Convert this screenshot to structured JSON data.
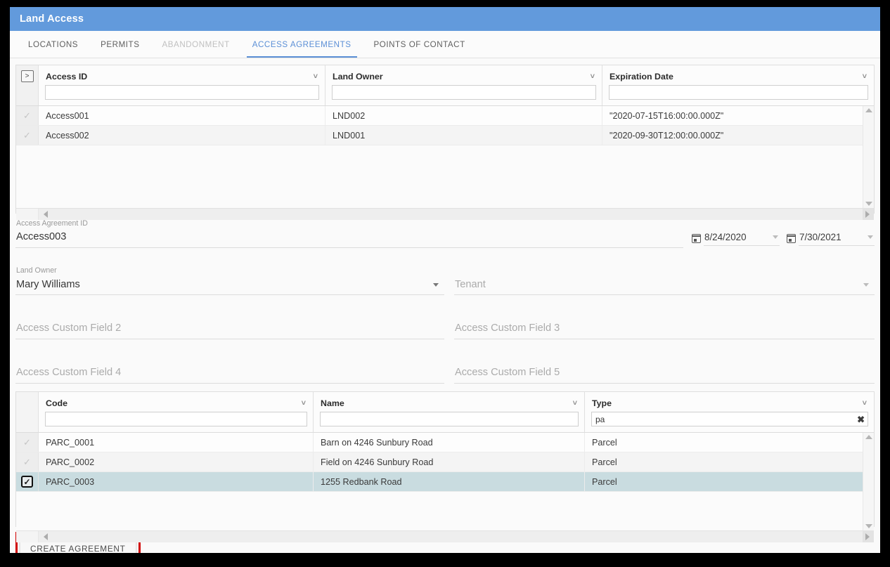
{
  "window": {
    "title": "Land Access"
  },
  "tabs": [
    {
      "label": "LOCATIONS",
      "state": "normal"
    },
    {
      "label": "PERMITS",
      "state": "normal"
    },
    {
      "label": "ABANDONMENT",
      "state": "disabled"
    },
    {
      "label": "ACCESS AGREEMENTS",
      "state": "active"
    },
    {
      "label": "POINTS OF CONTACT",
      "state": "normal"
    }
  ],
  "agreements_grid": {
    "expand_button_label": ">",
    "columns": [
      {
        "label": "Access ID",
        "filter_value": "",
        "filter_placeholder": ""
      },
      {
        "label": "Land Owner",
        "filter_value": "",
        "filter_placeholder": ""
      },
      {
        "label": "Expiration Date",
        "filter_value": "",
        "filter_placeholder": ""
      }
    ],
    "rows": [
      {
        "access_id": "Access001",
        "land_owner": "LND002",
        "expiration_date": "\"2020-07-15T16:00:00.000Z\"",
        "selected": false
      },
      {
        "access_id": "Access002",
        "land_owner": "LND001",
        "expiration_date": "\"2020-09-30T12:00:00.000Z\"",
        "selected": false
      }
    ]
  },
  "form": {
    "access_agreement_id": {
      "label": "Access Agreement ID",
      "value": "Access003"
    },
    "start_date": {
      "value": "8/24/2020"
    },
    "end_date": {
      "value": "7/30/2021"
    },
    "land_owner": {
      "label": "Land Owner",
      "value": "Mary Williams"
    },
    "tenant": {
      "placeholder": "Tenant",
      "value": ""
    },
    "custom_field_2": {
      "placeholder": "Access Custom Field 2",
      "value": ""
    },
    "custom_field_3": {
      "placeholder": "Access Custom Field 3",
      "value": ""
    },
    "custom_field_4": {
      "placeholder": "Access Custom Field 4",
      "value": ""
    },
    "custom_field_5": {
      "placeholder": "Access Custom Field 5",
      "value": ""
    }
  },
  "parcels_grid": {
    "columns": [
      {
        "label": "Code",
        "filter_value": "",
        "filter_placeholder": ""
      },
      {
        "label": "Name",
        "filter_value": "",
        "filter_placeholder": ""
      },
      {
        "label": "Type",
        "filter_value": "pa",
        "filter_placeholder": "",
        "clear_icon": "✖"
      }
    ],
    "rows": [
      {
        "code": "PARC_0001",
        "name": "Barn on 4246 Sunbury Road",
        "type": "Parcel",
        "selected": false
      },
      {
        "code": "PARC_0002",
        "name": "Field on 4246 Sunbury Road",
        "type": "Parcel",
        "selected": false
      },
      {
        "code": "PARC_0003",
        "name": "1255 Redbank Road",
        "type": "Parcel",
        "selected": true
      }
    ]
  },
  "footer": {
    "create_agreement_label": "CREATE AGREEMENT"
  },
  "colors": {
    "title_bar": "#629ADC",
    "active_tab": "#5b8fd6",
    "selected_row": "#c9dce0",
    "highlight_border": "#d00000"
  }
}
